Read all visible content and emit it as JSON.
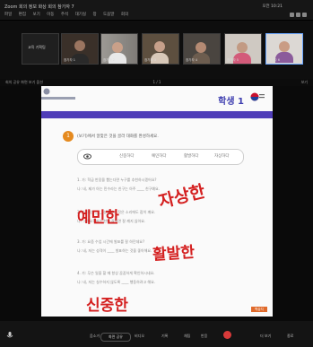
{
  "window": {
    "title": "Zoom  회의 정보  화상 회의 참가자 7",
    "clock": "오전 10:21",
    "menu": [
      "파일",
      "편집",
      "보기",
      "이동",
      "주석",
      "대기실",
      "창",
      "도움말",
      "회의"
    ]
  },
  "participants": [
    {
      "name": "교육 기획팀"
    },
    {
      "name": "참가자 1"
    },
    {
      "name": "참가자 2"
    },
    {
      "name": "참가자 3"
    },
    {
      "name": "참가자 4"
    },
    {
      "name": "참가자 5"
    },
    {
      "name": "참가자 6"
    }
  ],
  "navbar": {
    "left": "회의 공유 화면 보기 옵션",
    "center": "1 / 1",
    "right": "보기"
  },
  "slide": {
    "badge": "학생 1",
    "question_number": "1",
    "question_text": "(보기)에서 알맞은 것을 골라 대화를 완성하세요.",
    "options": [
      "신중하다",
      "예민하다",
      "활발하다",
      "자상하다"
    ],
    "lines": [
      "1. 가: 학급 반장을 뽑는다면 누구를 추천하시겠어요?",
      "    나: 네, 제가 아는 민수라는 친구는 아주 ____ 친구예요.",
      "2. 가: 저는 ____ 성격이라 작은 소리에도 잠이 깨요.",
      "    나: 그래요? 저는 한번 잠들면 잘 깨지 않아요.",
      "3. 가: 요즘 수업 시간에 발표를 잘 하던데요?",
      "    나: 네, 저는 성격이 ____ 발표하는 것을 좋아해요.",
      "4. 가: 무슨 일을 할 때 항상 꼼꼼하게 확인하시네요.",
      "    나: 네, 저는 실수하지 않도록 ____ 행동하려고 해요."
    ],
    "page_tag": "학습지"
  },
  "handwriting": [
    "자상한",
    "예민한",
    "활발한",
    "신중한"
  ],
  "bottom_bar": {
    "audio": "음소거",
    "video": "비디오",
    "share": "화면 공유",
    "record": "기록",
    "chat": "채팅",
    "reactions": "반응",
    "more": "더 보기",
    "end": "종료"
  }
}
